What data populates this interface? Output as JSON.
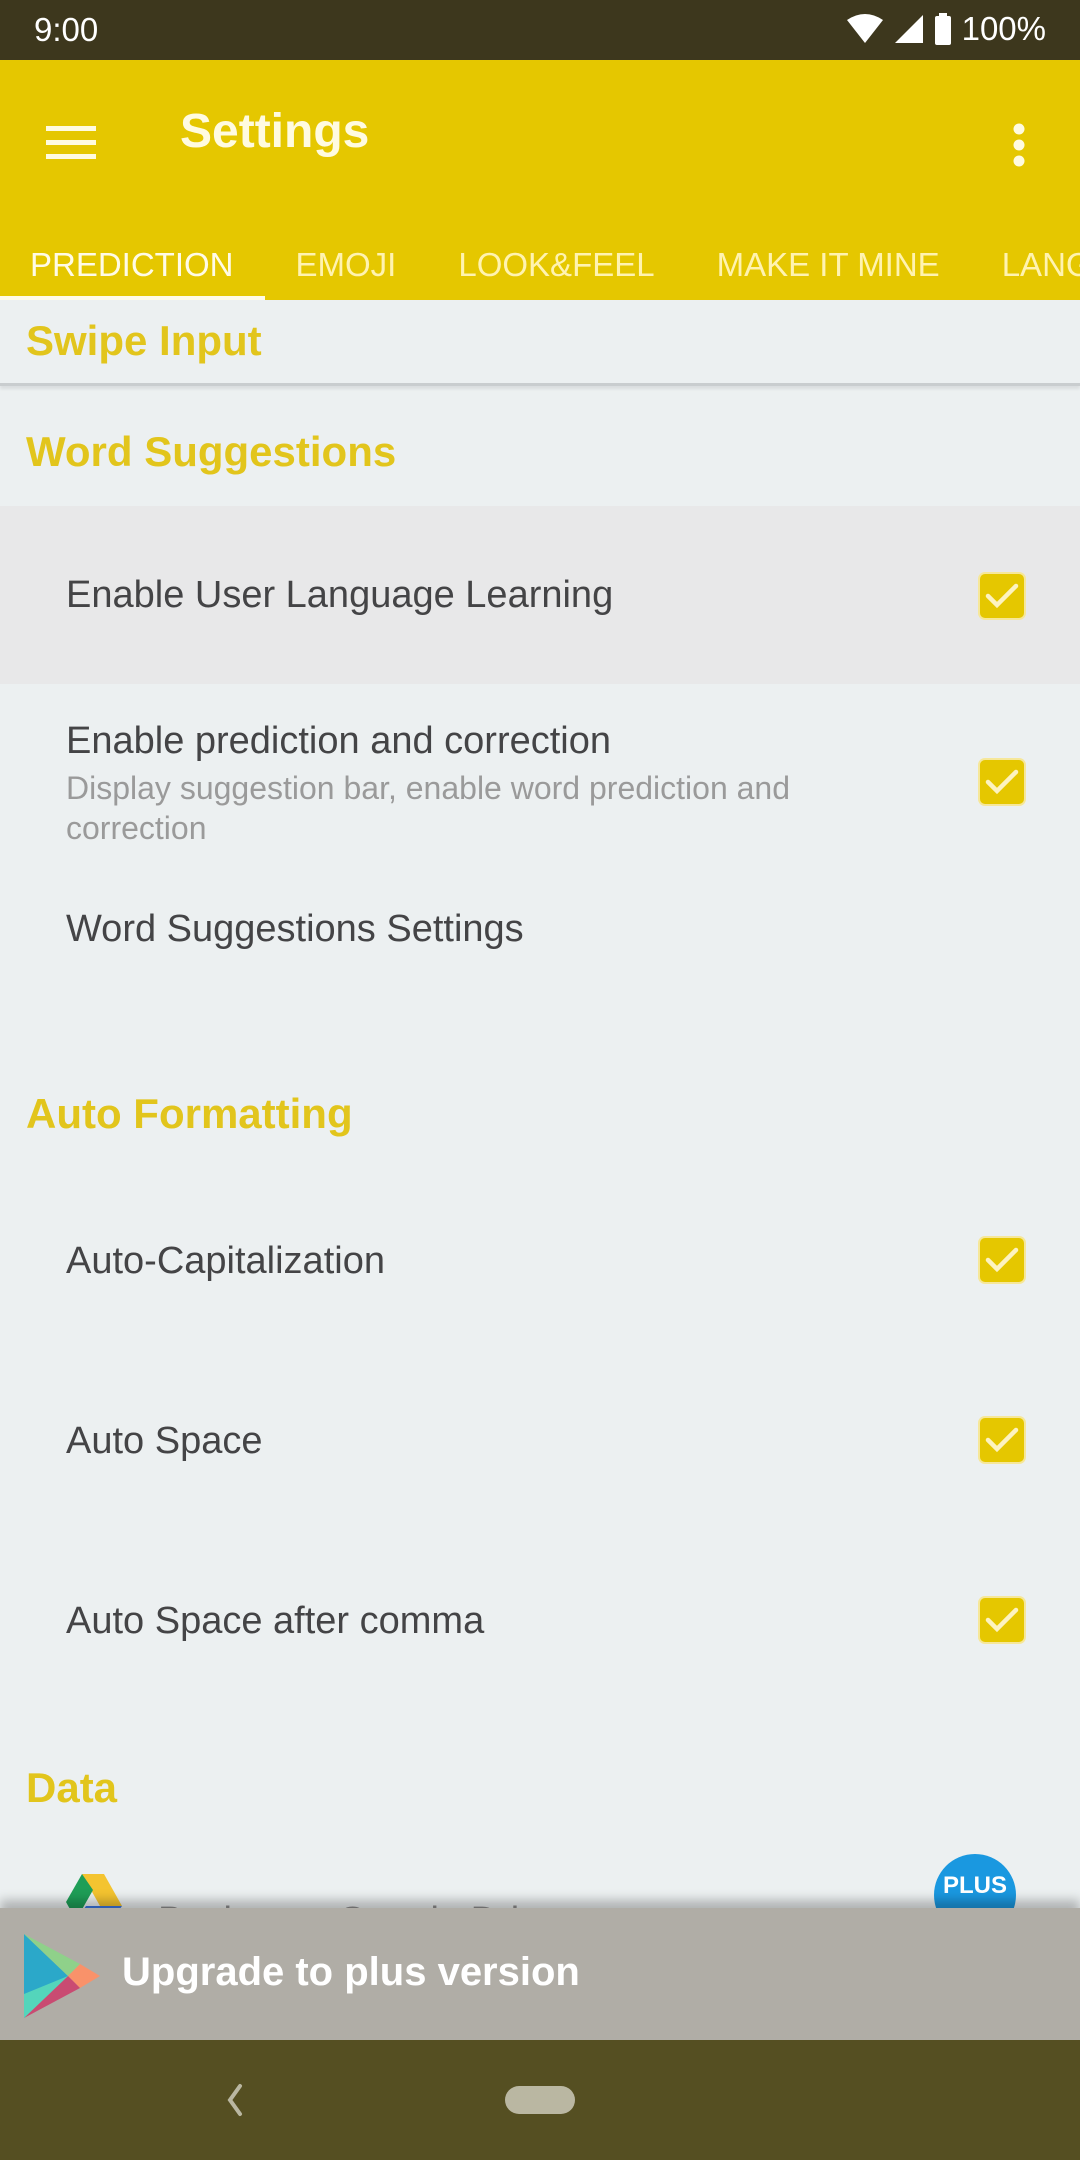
{
  "status_bar": {
    "time": "9:00",
    "battery": "100%",
    "icons": [
      "wifi-icon",
      "signal-icon",
      "battery-icon"
    ]
  },
  "app_bar": {
    "title": "Settings",
    "menu_icon": "hamburger-menu-icon",
    "overflow_icon": "more-vert-icon"
  },
  "tabs": [
    {
      "label": "PREDICTION",
      "active": true
    },
    {
      "label": "EMOJI",
      "active": false
    },
    {
      "label": "LOOK&FEEL",
      "active": false
    },
    {
      "label": "MAKE IT MINE",
      "active": false
    },
    {
      "label": "LANGUAGES",
      "active": false
    }
  ],
  "sections": {
    "swipe_input": "Swipe Input",
    "word_suggestions": {
      "header": "Word Suggestions",
      "items": [
        {
          "title": "Enable User Language Learning",
          "checked": true
        },
        {
          "title": "Enable prediction and correction",
          "summary": "Display suggestion bar, enable word prediction and correction",
          "checked": true
        },
        {
          "title": "Word Suggestions Settings"
        }
      ]
    },
    "auto_formatting": {
      "header": "Auto Formatting",
      "items": [
        {
          "title": "Auto-Capitalization",
          "checked": true
        },
        {
          "title": "Auto Space",
          "checked": true
        },
        {
          "title": "Auto Space after comma",
          "checked": true
        }
      ]
    },
    "data": {
      "header": "Data",
      "items": [
        {
          "title": "Backup to Google Drive",
          "badge": "PLUS"
        }
      ]
    }
  },
  "upgrade_banner": {
    "label": "Upgrade to plus version",
    "icon": "play-store-icon"
  },
  "colors": {
    "accent": "#e5c700",
    "status_bar": "#3d371d",
    "nav_bar": "#554f22",
    "badge": "#1a98e0"
  }
}
